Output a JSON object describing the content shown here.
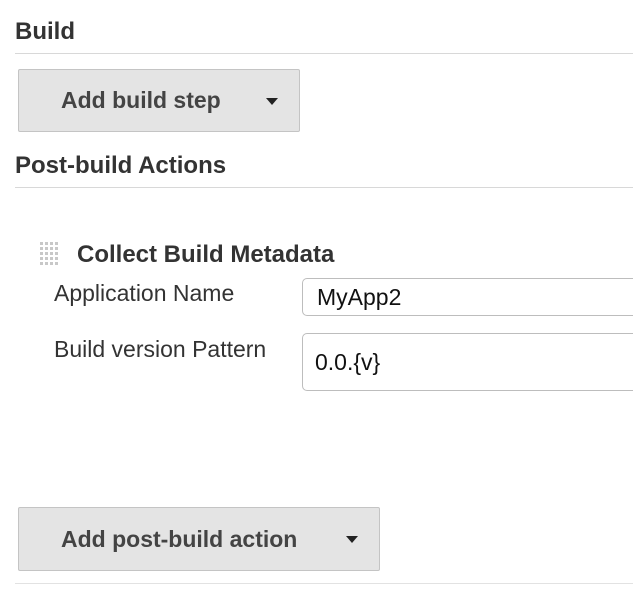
{
  "build": {
    "title": "Build",
    "add_step_label": "Add build step"
  },
  "post_build": {
    "title": "Post-build Actions",
    "step": {
      "title": "Collect Build Metadata",
      "fields": [
        {
          "label": "Application Name",
          "value": "MyApp2"
        },
        {
          "label": "Build version Pattern",
          "value": "0.0.{v}"
        }
      ]
    },
    "add_action_label": "Add post-build action"
  },
  "icons": {
    "drag_handle": "drag-handle-icon",
    "dropdown_caret": "chevron-down-icon"
  },
  "colors": {
    "button_bg": "#e4e4e4",
    "button_border": "#c4c4c4",
    "text": "#333333"
  }
}
